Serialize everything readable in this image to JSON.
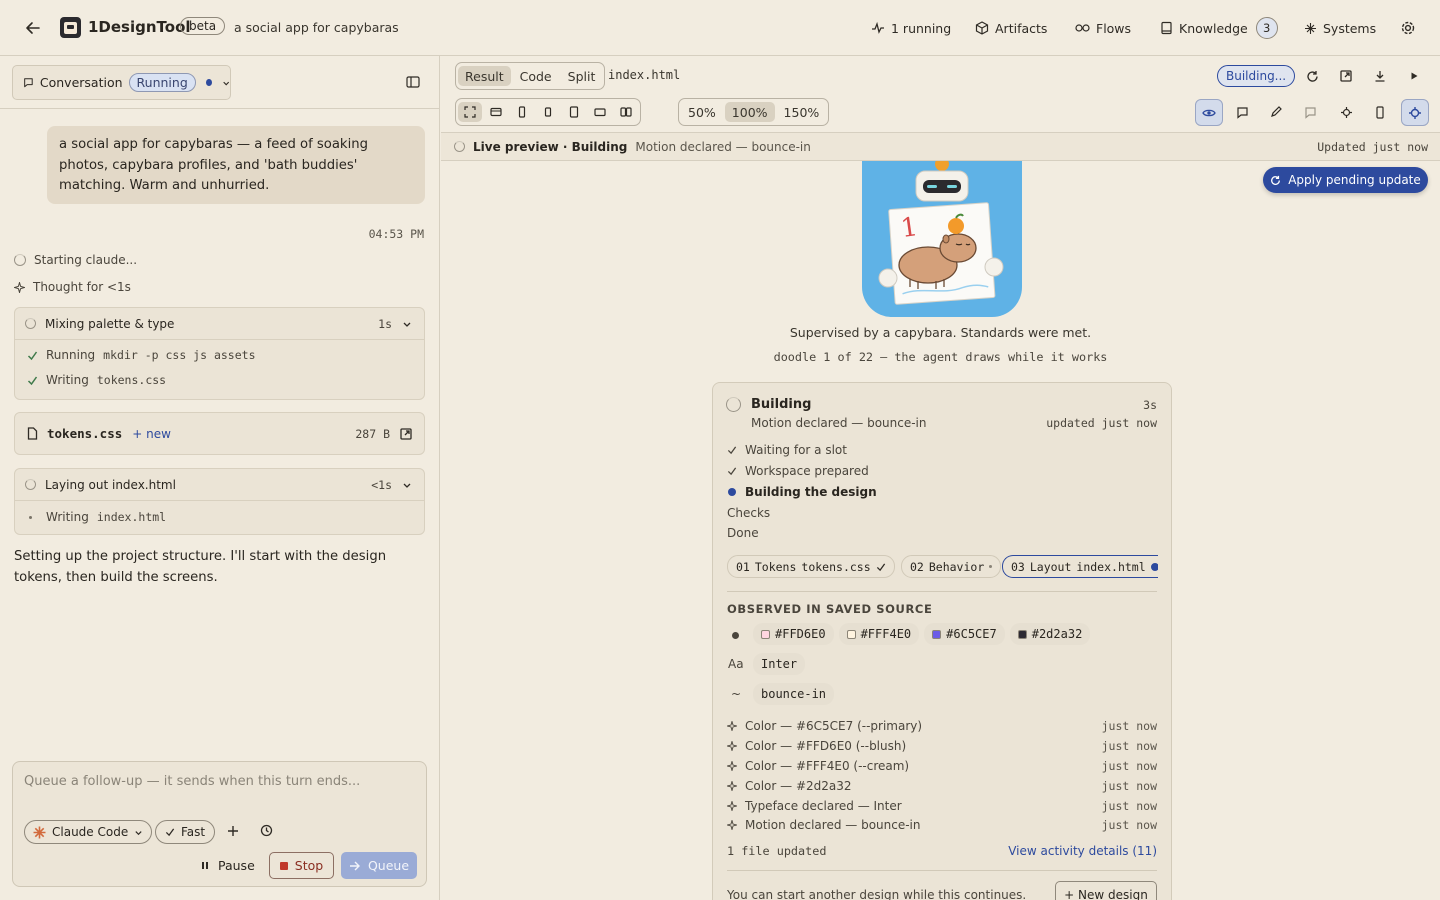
{
  "header": {
    "app_name": "1DesignTool",
    "beta_label": "beta",
    "project_title": "a social app for capybaras",
    "nav": [
      {
        "label": "1 running"
      },
      {
        "label": "Artifacts"
      },
      {
        "label": "Flows"
      },
      {
        "label": "Knowledge",
        "badge": "3"
      },
      {
        "label": "Systems"
      }
    ]
  },
  "conversation": {
    "tab_label": "Conversation",
    "status": "Running",
    "user_message": "a social app for capybaras — a feed of soaking photos, capybara profiles, and 'bath buddies' matching. Warm and unhurried.",
    "timestamp": "04:53 PM",
    "status_lines": [
      "Starting claude...",
      "Thought for <1s"
    ],
    "task1": {
      "title": "Mixing palette & type",
      "time": "1s",
      "items": [
        {
          "label": "Running",
          "code": "mkdir -p css js assets"
        },
        {
          "label": "Writing",
          "code": "tokens.css"
        }
      ]
    },
    "file_card": {
      "name": "tokens.css",
      "tag": "+ new",
      "size": "287 B"
    },
    "task2": {
      "title": "Laying out index.html",
      "time": "<1s",
      "items": [
        {
          "label": "Writing",
          "code": "index.html"
        }
      ]
    },
    "assistant_message": "Setting up the project structure. I'll start with the design tokens, then build the screens."
  },
  "composer": {
    "placeholder": "Queue a follow-up — it sends when this turn ends...",
    "model": "Claude Code",
    "speed": "Fast",
    "pause_label": "Pause",
    "stop_label": "Stop",
    "queue_label": "Queue"
  },
  "preview": {
    "view_tabs": [
      "Result",
      "Code",
      "Split"
    ],
    "filename": "index.html",
    "building_badge": "Building...",
    "zoom_options": [
      "50%",
      "100%",
      "150%"
    ],
    "status_title": "Live preview · Building",
    "status_detail": "Motion declared — bounce-in",
    "updated": "Updated just now",
    "apply_button": "Apply pending update",
    "caption": "Supervised by a capybara. Standards were met.",
    "doodle_caption": "doodle 1 of 22 — the agent draws while it works",
    "doodle_digit": "1"
  },
  "build_card": {
    "title": "Building",
    "subtitle": "Motion declared — bounce-in",
    "elapsed": "3s",
    "updated": "updated just now",
    "steps": [
      {
        "label": "Waiting for a slot",
        "state": "done"
      },
      {
        "label": "Workspace prepared",
        "state": "done"
      },
      {
        "label": "Building the design",
        "state": "active"
      },
      {
        "label": "Checks",
        "state": "pending"
      },
      {
        "label": "Done",
        "state": "pending"
      }
    ],
    "phases": [
      {
        "num": "01",
        "name": "Tokens",
        "file": "tokens.css",
        "state": "done"
      },
      {
        "num": "02",
        "name": "Behavior",
        "file": "",
        "state": "pending"
      },
      {
        "num": "03",
        "name": "Layout",
        "file": "index.html",
        "state": "active"
      }
    ],
    "observed_title": "OBSERVED IN SAVED SOURCE",
    "colors": [
      {
        "hex": "#FFD6E0",
        "swatch": "#FFD6E0"
      },
      {
        "hex": "#FFF4E0",
        "swatch": "#FFF4E0"
      },
      {
        "hex": "#6C5CE7",
        "swatch": "#6C5CE7"
      },
      {
        "hex": "#2d2a32",
        "swatch": "#2d2a32"
      }
    ],
    "typeface_label": "Aa",
    "typeface": "Inter",
    "motion_label": "~",
    "motion": "bounce-in",
    "activity": [
      {
        "text": "Color — #6C5CE7 (--primary)",
        "when": "just now"
      },
      {
        "text": "Color — #FFD6E0 (--blush)",
        "when": "just now"
      },
      {
        "text": "Color — #FFF4E0 (--cream)",
        "when": "just now"
      },
      {
        "text": "Color — #2d2a32",
        "when": "just now"
      },
      {
        "text": "Typeface declared — Inter",
        "when": "just now"
      },
      {
        "text": "Motion declared — bounce-in",
        "when": "just now"
      }
    ],
    "files_updated": "1 file updated",
    "view_details": "View activity details (11)",
    "footer_note": "You can start another design while this continues.",
    "new_design": "+ New design"
  },
  "colors": {
    "accent": "#2d4a9e",
    "running_pill_bg": "#d9e2f3",
    "stop_red": "#c0392b",
    "queue_btn": "#9aabd6"
  }
}
